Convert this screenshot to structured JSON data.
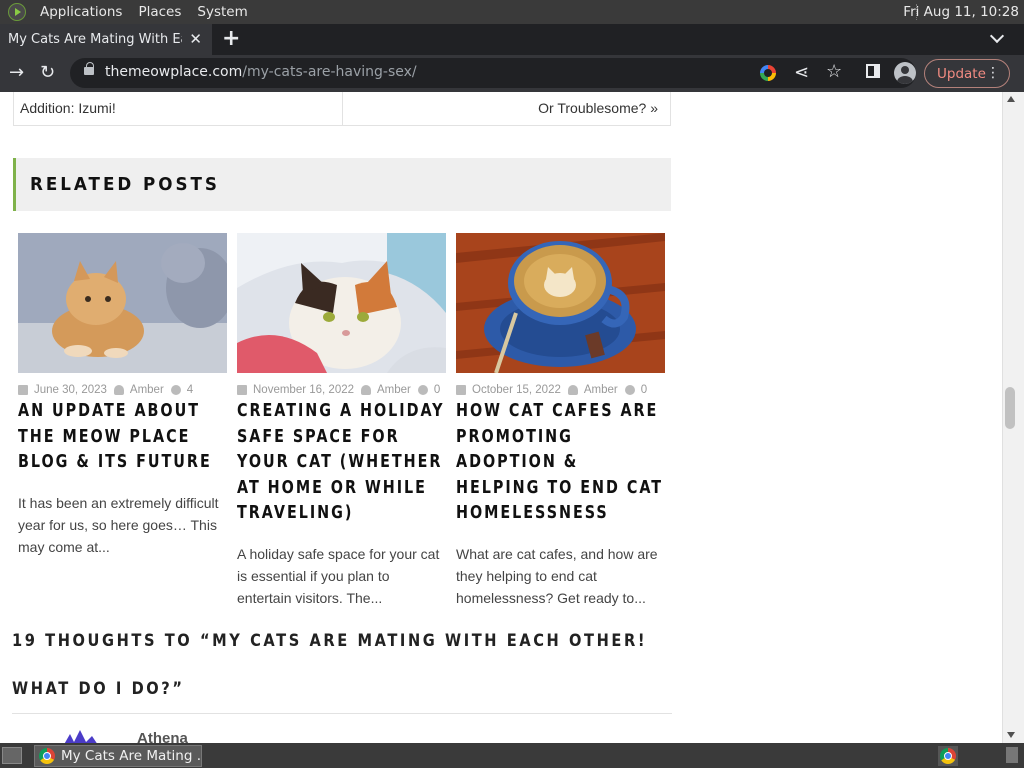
{
  "os_panel": {
    "menus": [
      "Applications",
      "Places",
      "System"
    ],
    "clock": "Fri Aug 11, 10:28"
  },
  "browser": {
    "tab_title": "My Cats Are Mating With Each Other! What Do I Do?",
    "url_host": "themeowplace.com",
    "url_path": "/my-cats-are-having-sex/",
    "update_label": "Update"
  },
  "post_nav": {
    "prev": "Addition: Izumi!",
    "next": "Or Troublesome? »"
  },
  "related": {
    "heading": "RELATED POSTS",
    "posts": [
      {
        "date": "June 30, 2023",
        "author": "Amber",
        "comments": "4",
        "title": "An Update About The Meow Place Blog & Its Future",
        "excerpt": "It has been an extremely difficult year for us, so here goes… This may come at...",
        "image": "orange-kitten-photo"
      },
      {
        "date": "November 16, 2022",
        "author": "Amber",
        "comments": "0",
        "title": "Creating A Holiday Safe Space For Your Cat (Whether At Home Or While Traveling)",
        "excerpt": "A holiday safe space for your cat is essential if you plan to entertain visitors. The...",
        "image": "calico-cat-under-blanket-photo"
      },
      {
        "date": "October 15, 2022",
        "author": "Amber",
        "comments": "0",
        "title": "How Cat Cafes Are Promoting Adoption & Helping To End Cat Homelessness",
        "excerpt": "What are cat cafes, and how are they helping to end cat homelessness? Get ready to...",
        "image": "cat-latte-art-photo"
      }
    ]
  },
  "comments": {
    "title": "19 thoughts to “My Cats Are Mating With Each Other! What Do I Do?”",
    "first_author": "Athena"
  },
  "taskbar": {
    "task_label": "My Cats Are Mating ..."
  }
}
